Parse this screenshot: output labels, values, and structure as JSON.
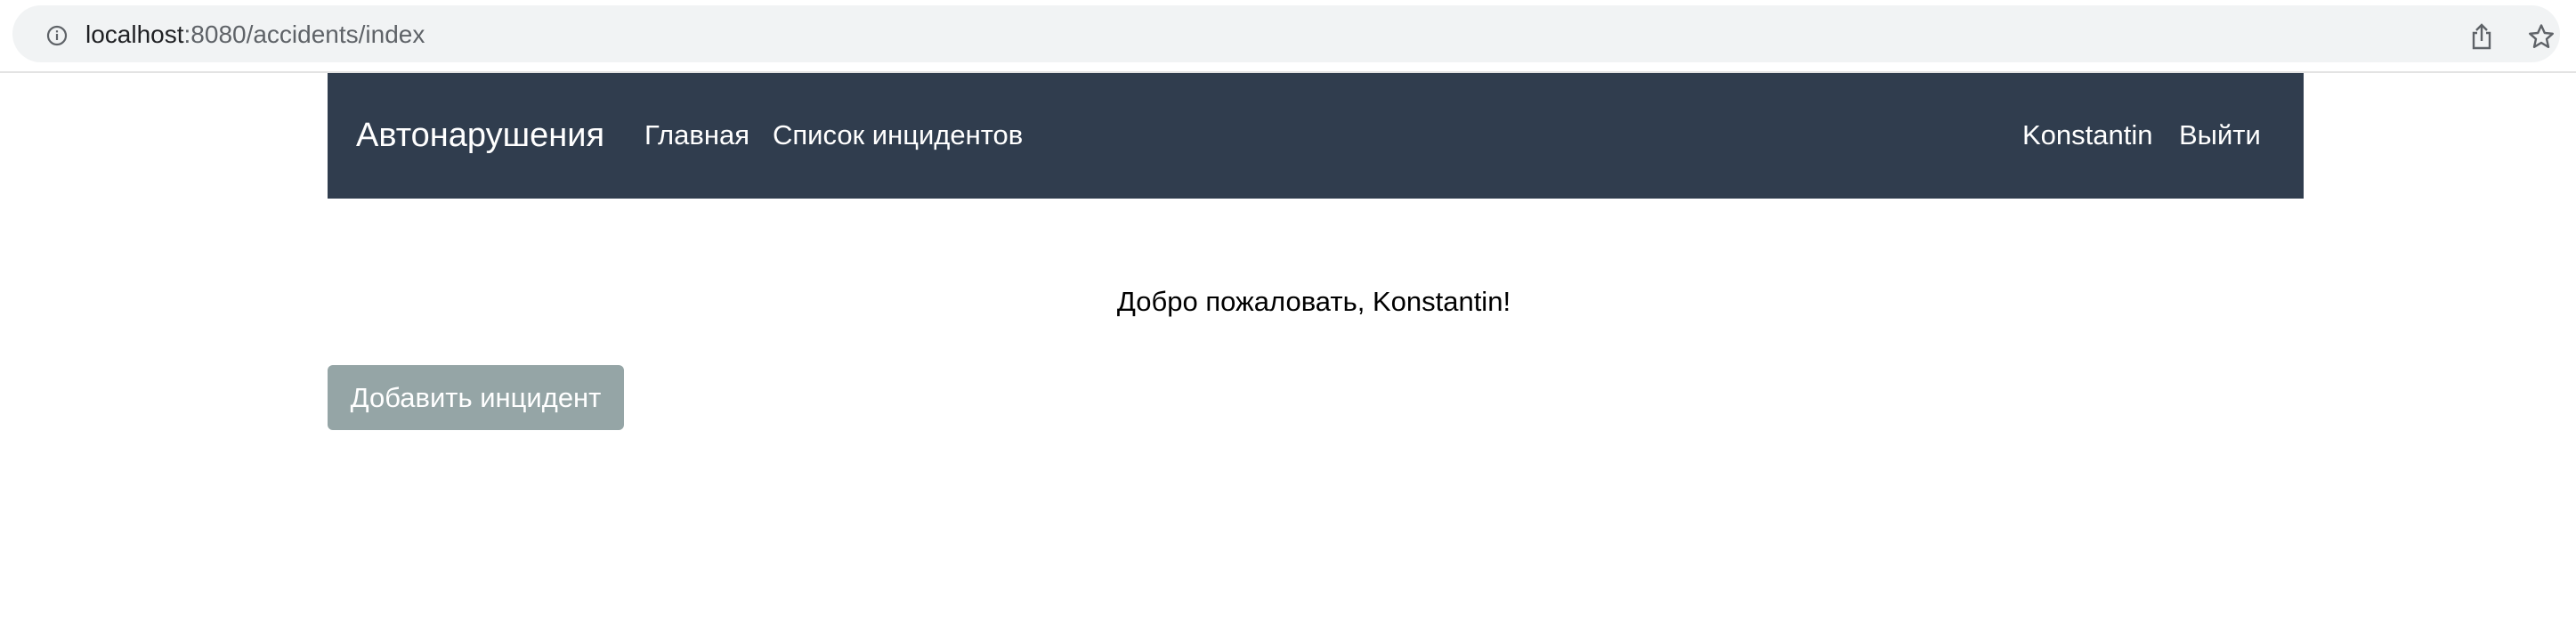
{
  "browser": {
    "url_host": "localhost",
    "url_path": ":8080/accidents/index",
    "icons": [
      "info-icon",
      "share-icon",
      "star-icon"
    ]
  },
  "navbar": {
    "brand": "Автонарушения",
    "links": [
      "Главная",
      "Список инцидентов"
    ],
    "user": "Konstantin",
    "logout": "Выйти",
    "background": "#303d4e"
  },
  "main": {
    "welcome": "Добро пожаловать, Konstantin!",
    "add_button_label": "Добавить инцидент",
    "add_button_color": "#95a5a6"
  }
}
